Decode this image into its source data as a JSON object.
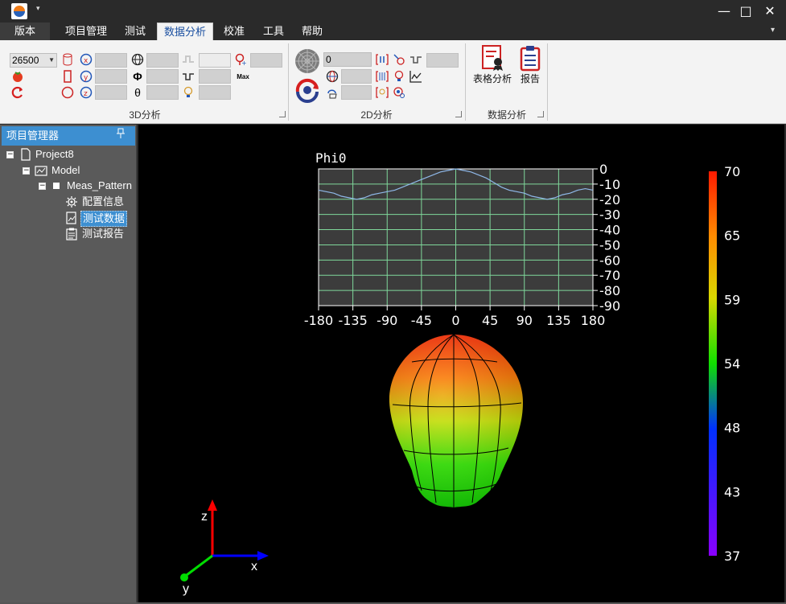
{
  "ribbon_tabs": {
    "file": "版本",
    "project": "项目管理",
    "test": "测试",
    "analysis": "数据分析",
    "calibrate": "校准",
    "tools": "工具",
    "help": "帮助"
  },
  "ribbon": {
    "frequency_value": "26500",
    "label_max": "Max",
    "label_phi": "Φ",
    "label_theta": "θ",
    "field_2d_value": "0",
    "group_3d": "3D分析",
    "group_2d": "2D分析",
    "group_data": "数据分析",
    "table_analysis": "表格分析",
    "report": "报告"
  },
  "sidebar": {
    "title": "项目管理器",
    "tree": {
      "project": "Project8",
      "model": "Model",
      "meas": "Meas_Pattern",
      "config": "配置信息",
      "test_data": "测试数据",
      "test_report": "测试报告"
    }
  },
  "axes_gizmo": {
    "z": "z",
    "x": "x",
    "y": "y"
  },
  "colors": {
    "accent": "#3d8fd1",
    "grid": "#7fd79a",
    "curve": "#8fb8e8",
    "plot_bg": "#3c3c3c"
  },
  "chart_data": {
    "type": "line",
    "title": "Phi0",
    "xlabel": "",
    "ylabel": "",
    "xlim": [
      -180,
      180
    ],
    "ylim": [
      -90,
      0
    ],
    "xticks": [
      "-180",
      "-135",
      "-90",
      "-45",
      "0",
      "45",
      "90",
      "135",
      "180"
    ],
    "yticks": [
      "0",
      "-10",
      "-20",
      "-30",
      "-40",
      "-50",
      "-60",
      "-70",
      "-80",
      "-90"
    ],
    "grid": true,
    "series": [
      {
        "x": [
          -180,
          -170,
          -160,
          -150,
          -140,
          -130,
          -120,
          -110,
          -100,
          -90,
          -80,
          -70,
          -60,
          -50,
          -40,
          -30,
          -20,
          -10,
          0,
          10,
          20,
          30,
          40,
          50,
          60,
          70,
          80,
          90,
          100,
          110,
          120,
          130,
          140,
          150,
          160,
          170,
          180
        ],
        "y": [
          -14,
          -15,
          -16,
          -18,
          -19,
          -20,
          -19,
          -17,
          -16,
          -15,
          -14,
          -12,
          -10,
          -8,
          -6,
          -4,
          -2,
          -1,
          0,
          -1,
          -2,
          -4,
          -6,
          -9,
          -12,
          -14,
          -15,
          -16,
          -18,
          -19,
          -20,
          -19,
          -17,
          -16,
          -14,
          -13,
          -14
        ]
      }
    ]
  },
  "colorbar": {
    "labels": [
      "70",
      "65",
      "59",
      "54",
      "48",
      "43",
      "37"
    ]
  }
}
